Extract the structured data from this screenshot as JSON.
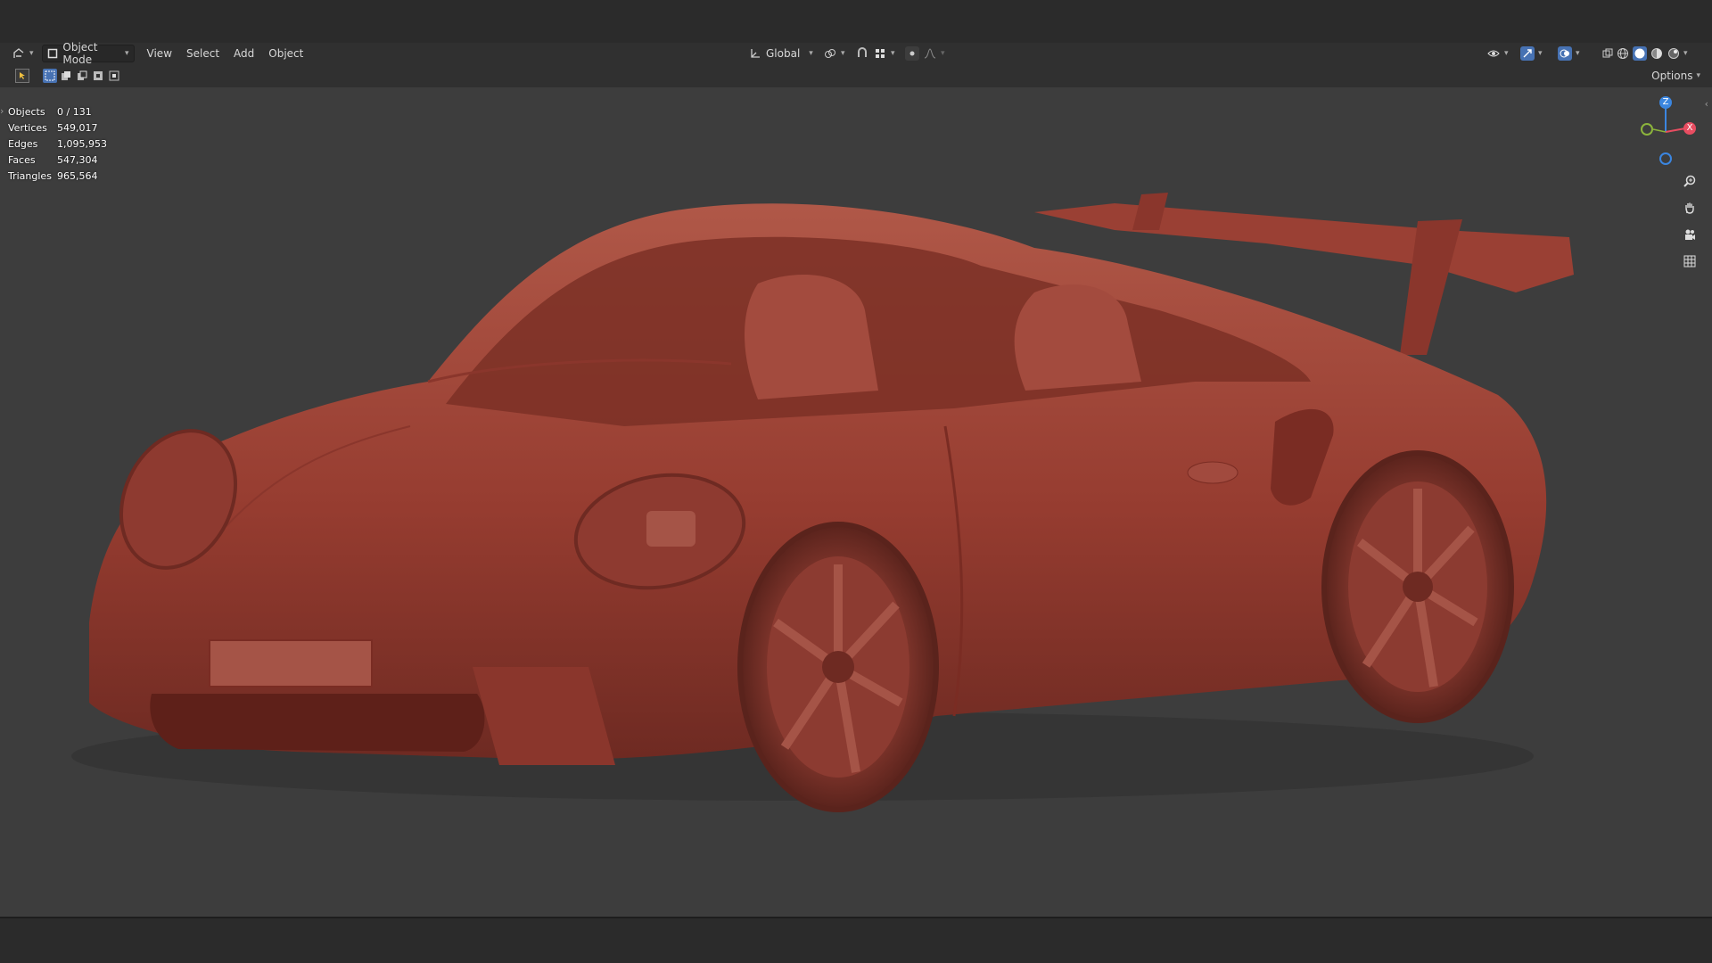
{
  "header": {
    "editor_type_icon": "editor-type-icon",
    "mode_label": "Object Mode",
    "menus": [
      "View",
      "Select",
      "Add",
      "Object"
    ],
    "transform_orientation": "Global",
    "icons": {
      "pivot": "pivot-point-icon",
      "snap": "snap-icon",
      "proportional": "proportional-edit-icon",
      "visibility": "visibility-icon",
      "gizmo": "gizmo-toggle-icon",
      "overlay": "overlay-icon",
      "xray": "xray-icon",
      "shading": [
        "wireframe-shading-icon",
        "solid-shading-icon",
        "material-shading-icon",
        "rendered-shading-icon"
      ]
    }
  },
  "toolbar": {
    "select_tool_icon": "select-box-icon",
    "select_modes": [
      "new-selection-icon",
      "extend-selection-icon",
      "subtract-selection-icon",
      "invert-selection-icon",
      "intersect-selection-icon"
    ],
    "options_label": "Options"
  },
  "stats": [
    {
      "label": "Objects",
      "value": "0 / 131"
    },
    {
      "label": "Vertices",
      "value": "549,017"
    },
    {
      "label": "Edges",
      "value": "1,095,953"
    },
    {
      "label": "Faces",
      "value": "547,304"
    },
    {
      "label": "Triangles",
      "value": "965,564"
    }
  ],
  "gizmo": {
    "z_label": "Z",
    "x_label": "X",
    "colors": {
      "x": "#e84d61",
      "y": "#8cb43c",
      "z": "#3b86e0"
    }
  },
  "nav_buttons": [
    "zoom-icon",
    "pan-hand-icon",
    "camera-view-icon",
    "grid-projection-icon"
  ],
  "colors": {
    "model": "#9c3d33",
    "viewport_bg": "#3d3d3d",
    "accent": "#4772b3"
  }
}
